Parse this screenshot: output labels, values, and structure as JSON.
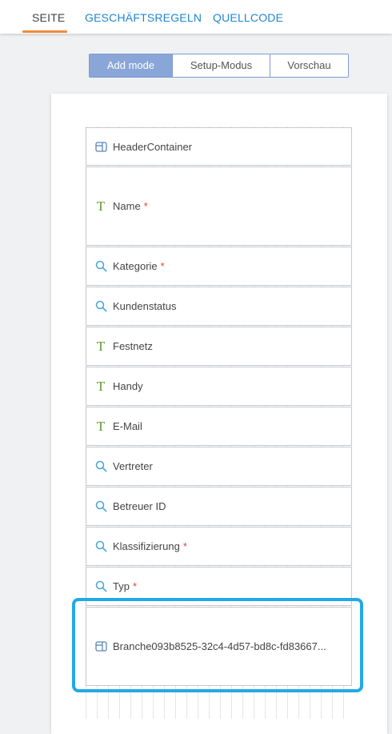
{
  "tabs": [
    {
      "label": "SEITE",
      "active": true
    },
    {
      "label": "GESCHÄFTSREGELN",
      "active": false
    },
    {
      "label": "QUELLCODE",
      "active": false
    }
  ],
  "modes": [
    {
      "label": "Add mode",
      "active": true
    },
    {
      "label": "Setup-Modus",
      "active": false
    },
    {
      "label": "Vorschau",
      "active": false
    }
  ],
  "fields": [
    {
      "label": "HeaderContainer",
      "icon": "container-icon",
      "required": false
    },
    {
      "label": "Name",
      "icon": "text-icon",
      "required": true
    },
    {
      "label": "Kategorie",
      "icon": "search-icon",
      "required": true
    },
    {
      "label": "Kundenstatus",
      "icon": "search-icon",
      "required": false
    },
    {
      "label": "Festnetz",
      "icon": "text-icon",
      "required": false
    },
    {
      "label": "Handy",
      "icon": "text-icon",
      "required": false
    },
    {
      "label": "E-Mail",
      "icon": "text-icon",
      "required": false
    },
    {
      "label": "Vertreter",
      "icon": "search-icon",
      "required": false
    },
    {
      "label": "Betreuer ID",
      "icon": "search-icon",
      "required": false
    },
    {
      "label": "Klassifizierung",
      "icon": "search-icon",
      "required": true
    },
    {
      "label": "Typ",
      "icon": "search-icon",
      "required": true
    },
    {
      "label": "Branche093b8525-32c4-4d57-bd8c-fd83667...",
      "icon": "container-icon",
      "required": false
    }
  ],
  "required_marker": "*",
  "colors": {
    "accent_tab": "#f08a3c",
    "link": "#1f86d0",
    "mode_active": "#8aa6d8",
    "required": "#e0403a",
    "text_icon": "#5f9b2f",
    "search_icon": "#4aa3df",
    "highlight": "#21a9e6"
  }
}
